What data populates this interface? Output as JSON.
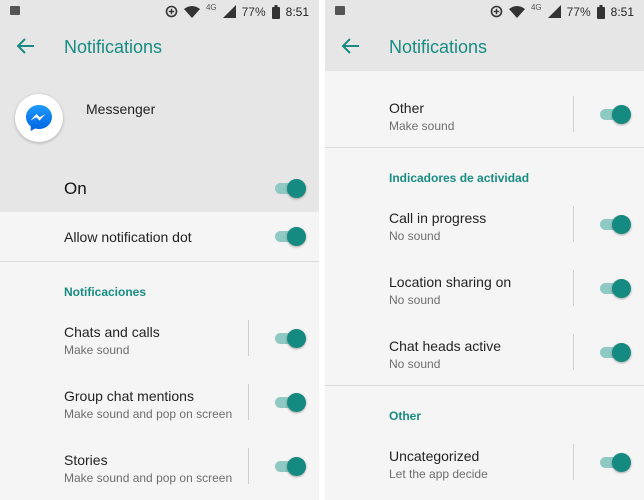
{
  "status_bar": {
    "network_label": "4G",
    "battery": "77%",
    "time": "8:51"
  },
  "left_panel": {
    "title": "Notifications",
    "app_name": "Messenger",
    "master_toggle_label": "On",
    "allow_dot_label": "Allow notification dot",
    "section_label": "Notificaciones",
    "items": [
      {
        "title": "Chats and calls",
        "subtitle": "Make sound"
      },
      {
        "title": "Group chat mentions",
        "subtitle": "Make sound and pop on screen"
      },
      {
        "title": "Stories",
        "subtitle": "Make sound and pop on screen"
      }
    ]
  },
  "right_panel": {
    "title": "Notifications",
    "top_item": {
      "title": "Other",
      "subtitle": "Make sound"
    },
    "section_activity": "Indicadores de actividad",
    "activity_items": [
      {
        "title": "Call in progress",
        "subtitle": "No sound"
      },
      {
        "title": "Location sharing on",
        "subtitle": "No sound"
      },
      {
        "title": "Chat heads active",
        "subtitle": "No sound"
      }
    ],
    "section_other": "Other",
    "other_items": [
      {
        "title": "Uncategorized",
        "subtitle": "Let the app decide"
      }
    ]
  },
  "colors": {
    "accent": "#188c83",
    "toggle_thumb": "#148a80",
    "toggle_track": "#8fc9c3",
    "header_bg": "#e6e6e6",
    "content_bg": "#f5f5f5"
  },
  "icons": {
    "back": "arrow-back-icon",
    "app": "messenger-icon",
    "status": [
      "image-icon",
      "data-saver-icon",
      "wifi-icon",
      "signal-icon",
      "battery-icon"
    ]
  }
}
